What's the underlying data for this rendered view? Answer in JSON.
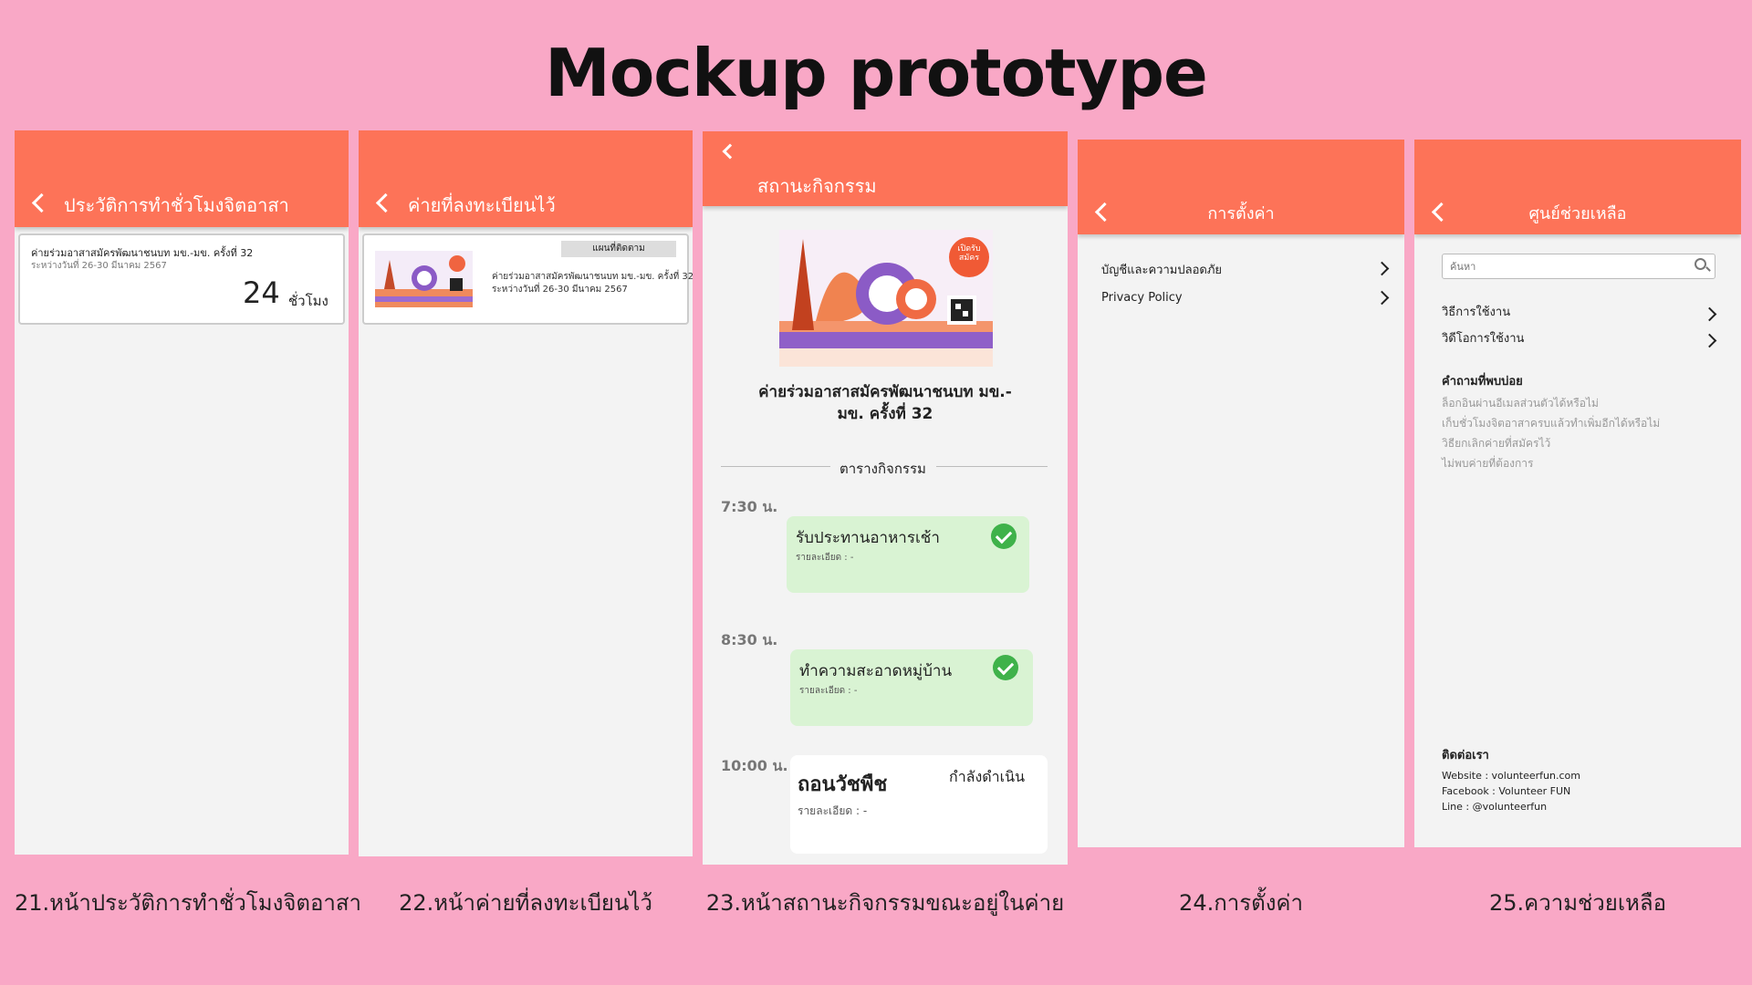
{
  "page_title": "Mockup prototype",
  "captions": [
    "21.หน้าประวัติการทำชั่วโมงจิตอาสา",
    "22.หน้าค่ายที่ลงทะเบียนไว้",
    "23.หน้าสถานะกิจกรรมขณะอยู่ในค่าย",
    "24.การตั้งค่า",
    "25.ความช่วยเหลือ"
  ],
  "screen21": {
    "header": "ประวัติการทำชั่วโมงจิตอาสา",
    "card": {
      "name": "ค่ายร่วมอาสาสมัครพัฒนาชนบท มข.-มข. ครั้งที่ 32",
      "date": "ระหว่างวันที่ 26-30 มีนาคม 2567",
      "hours": "24",
      "unit": "ชั่วโมง"
    }
  },
  "screen22": {
    "header": "ค่ายที่ลงทะเบียนไว้",
    "card": {
      "badge": "แผนที่ติดตาม",
      "name": "ค่ายร่วมอาสาสมัครพัฒนาชนบท มข.-มข. ครั้งที่ 32",
      "date": "ระหว่างวันที่ 26-30 มีนาคม 2567"
    }
  },
  "screen23": {
    "header": "สถานะกิจกรรม",
    "camp_name_line1": "ค่ายร่วมอาสาสมัครพัฒนาชนบท มข.-",
    "camp_name_line2": "มข. ครั้งที่ 32",
    "poster_badge": "เปิดรับสมัคร",
    "schedule_label": "ตารางกิจกรรม",
    "activities": [
      {
        "time": "7:30 น.",
        "title": "รับประทานอาหารเช้า",
        "detail": "รายละเอียด : -",
        "status": "done"
      },
      {
        "time": "8:30 น.",
        "title": "ทำความสะอาดหมู่บ้าน",
        "detail": "รายละเอียด : -",
        "status": "done"
      },
      {
        "time": "10:00 น.",
        "title": "ถอนวัชพืช",
        "detail": "รายละเอียด : -",
        "status": "กำลังดำเนิน"
      }
    ]
  },
  "screen24": {
    "header": "การตั้งค่า",
    "items": [
      "บัญชีและความปลอดภัย",
      "Privacy Policy"
    ]
  },
  "screen25": {
    "header": "ศูนย์ช่วยเหลือ",
    "search_placeholder": "ค้นหา",
    "items": [
      "วิธีการใช้งาน",
      "วิดีโอการใช้งาน"
    ],
    "faq_title": "คำถามที่พบบ่อย",
    "faq": [
      "ล็อกอินผ่านอีเมลส่วนตัวได้หรือไม่",
      "เก็บชั่วโมงจิตอาสาครบแล้วทำเพิ่มอีกได้หรือไม่",
      "วิธียกเลิกค่ายที่สมัครไว้",
      "ไม่พบค่ายที่ต้องการ"
    ],
    "contact_title": "ติดต่อเรา",
    "contacts": [
      "Website : volunteerfun.com",
      "Facebook : Volunteer FUN",
      "Line : @volunteerfun"
    ]
  },
  "colors": {
    "background": "#f9a8c6",
    "header": "#fd7358",
    "done_card": "#d9f3d3",
    "check": "#3fb24a"
  },
  "icons": [
    "back-arrow-icon",
    "chevron-right-icon",
    "search-icon",
    "check-circle-icon"
  ]
}
